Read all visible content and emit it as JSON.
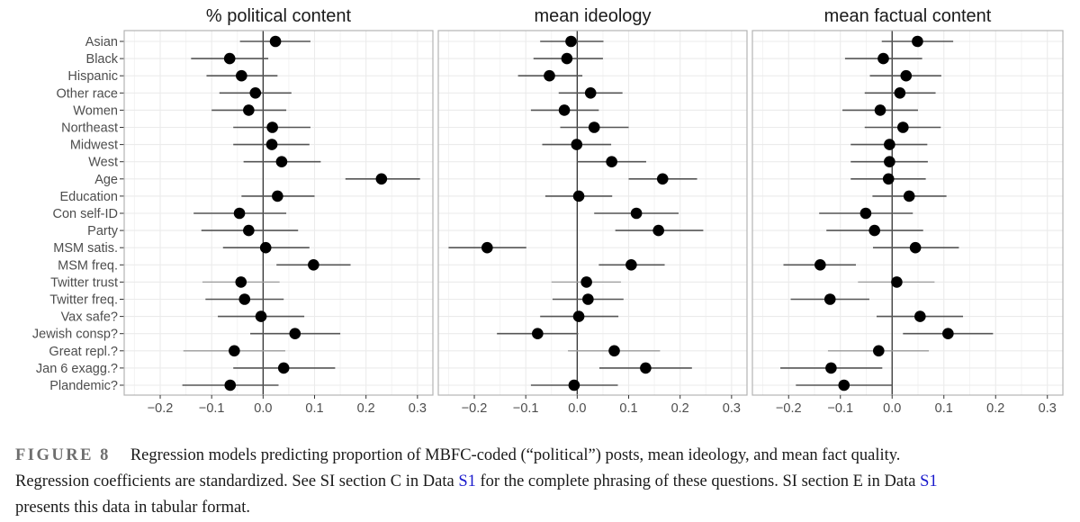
{
  "chart_data": {
    "type": "scatter",
    "subtype": "coefficient-plot with horizontal confidence intervals",
    "categories": [
      "Asian",
      "Black",
      "Hispanic",
      "Other race",
      "Women",
      "Northeast",
      "Midwest",
      "West",
      "Age",
      "Education",
      "Con self-ID",
      "Party",
      "MSM satis.",
      "MSM freq.",
      "Twitter trust",
      "Twitter freq.",
      "Vax safe?",
      "Jewish consp?",
      "Great repl.?",
      "Jan 6 exagg.?",
      "Plandemic?"
    ],
    "xlim": [
      -0.27,
      0.33
    ],
    "x_ticks": [
      -0.2,
      -0.1,
      0.0,
      0.1,
      0.2,
      0.3
    ],
    "x_tick_labels": [
      "−0.2",
      "−0.1",
      "0.0",
      "0.1",
      "0.2",
      "0.3"
    ],
    "grid": true,
    "reference_line": 0,
    "lighter_ci_rows": [
      "Twitter trust",
      "Great repl.?"
    ],
    "colors": {
      "point": "#000000",
      "ci": "#555555",
      "ci_light": "#9a9a9a",
      "grid": "#ebebeb",
      "frame": "#b3b3b3",
      "zero": "#333333"
    },
    "panels": [
      {
        "title": "% political content",
        "estimate": [
          0.024,
          -0.065,
          -0.042,
          -0.015,
          -0.028,
          0.018,
          0.017,
          0.036,
          0.23,
          0.028,
          -0.046,
          -0.028,
          0.005,
          0.098,
          -0.043,
          -0.036,
          -0.004,
          0.062,
          -0.056,
          0.04,
          -0.064
        ],
        "ci_low": [
          -0.045,
          -0.14,
          -0.11,
          -0.085,
          -0.1,
          -0.058,
          -0.058,
          -0.038,
          0.16,
          -0.042,
          -0.135,
          -0.12,
          -0.078,
          0.026,
          -0.118,
          -0.112,
          -0.088,
          -0.025,
          -0.155,
          -0.058,
          -0.157
        ],
        "ci_high": [
          0.092,
          0.01,
          0.028,
          0.055,
          0.045,
          0.092,
          0.09,
          0.112,
          0.305,
          0.1,
          0.045,
          0.068,
          0.09,
          0.17,
          0.032,
          0.04,
          0.08,
          0.15,
          0.043,
          0.14,
          0.03
        ]
      },
      {
        "title": "mean ideology",
        "estimate": [
          -0.012,
          -0.02,
          -0.054,
          0.026,
          -0.025,
          0.033,
          -0.001,
          0.067,
          0.166,
          0.003,
          0.115,
          0.158,
          -0.175,
          0.105,
          0.018,
          0.021,
          0.003,
          -0.077,
          0.072,
          0.133,
          -0.006
        ],
        "ci_low": [
          -0.072,
          -0.085,
          -0.115,
          -0.036,
          -0.09,
          -0.033,
          -0.068,
          0.0,
          0.1,
          -0.062,
          0.033,
          0.074,
          -0.25,
          0.042,
          -0.05,
          -0.048,
          -0.072,
          -0.156,
          -0.018,
          0.043,
          -0.09
        ],
        "ci_high": [
          0.051,
          0.05,
          0.01,
          0.088,
          0.042,
          0.1,
          0.066,
          0.134,
          0.233,
          0.068,
          0.197,
          0.245,
          -0.099,
          0.17,
          0.085,
          0.09,
          0.08,
          0.002,
          0.161,
          0.223,
          0.079
        ]
      },
      {
        "title": "mean factual content",
        "estimate": [
          0.049,
          -0.017,
          0.027,
          0.015,
          -0.023,
          0.021,
          -0.005,
          -0.005,
          -0.007,
          0.033,
          -0.051,
          -0.034,
          0.045,
          -0.139,
          0.009,
          -0.12,
          0.054,
          0.108,
          -0.026,
          -0.118,
          -0.093
        ],
        "ci_low": [
          -0.02,
          -0.091,
          -0.043,
          -0.053,
          -0.096,
          -0.053,
          -0.08,
          -0.08,
          -0.08,
          -0.038,
          -0.141,
          -0.127,
          -0.037,
          -0.21,
          -0.066,
          -0.196,
          -0.03,
          0.021,
          -0.124,
          -0.216,
          -0.186
        ],
        "ci_high": [
          0.118,
          0.058,
          0.095,
          0.084,
          0.05,
          0.094,
          0.068,
          0.069,
          0.065,
          0.105,
          0.04,
          0.06,
          0.129,
          -0.07,
          0.082,
          -0.044,
          0.137,
          0.195,
          0.071,
          -0.019,
          0.0
        ]
      }
    ]
  },
  "caption": {
    "label": "FIGURE 8",
    "line1": "Regression models predicting proportion of MBFC-coded (“political”) posts, mean ideology, and mean fact quality.",
    "line2_pre": "Regression coefficients are standardized. See SI section C in Data ",
    "line2_link": "S1",
    "line2_post": " for the complete phrasing of these questions. SI section E in Data ",
    "line2_link2": "S1",
    "line3": "presents this data in tabular format."
  }
}
